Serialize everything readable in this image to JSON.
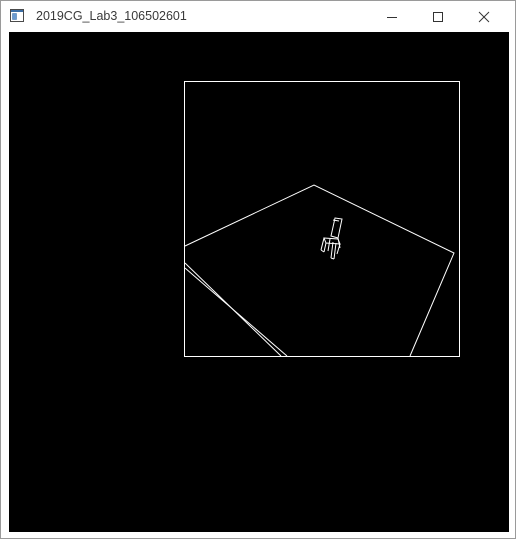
{
  "window": {
    "title": "2019CG_Lab3_106502601",
    "icons": {
      "app": "app-window-icon",
      "minimize": "minimize-icon",
      "maximize": "maximize-icon",
      "close": "close-icon"
    },
    "colors": {
      "titlebar": "#ffffff",
      "title_text": "#3a3a3a",
      "viewport_background": "#000000",
      "line": "#ffffff"
    }
  }
}
